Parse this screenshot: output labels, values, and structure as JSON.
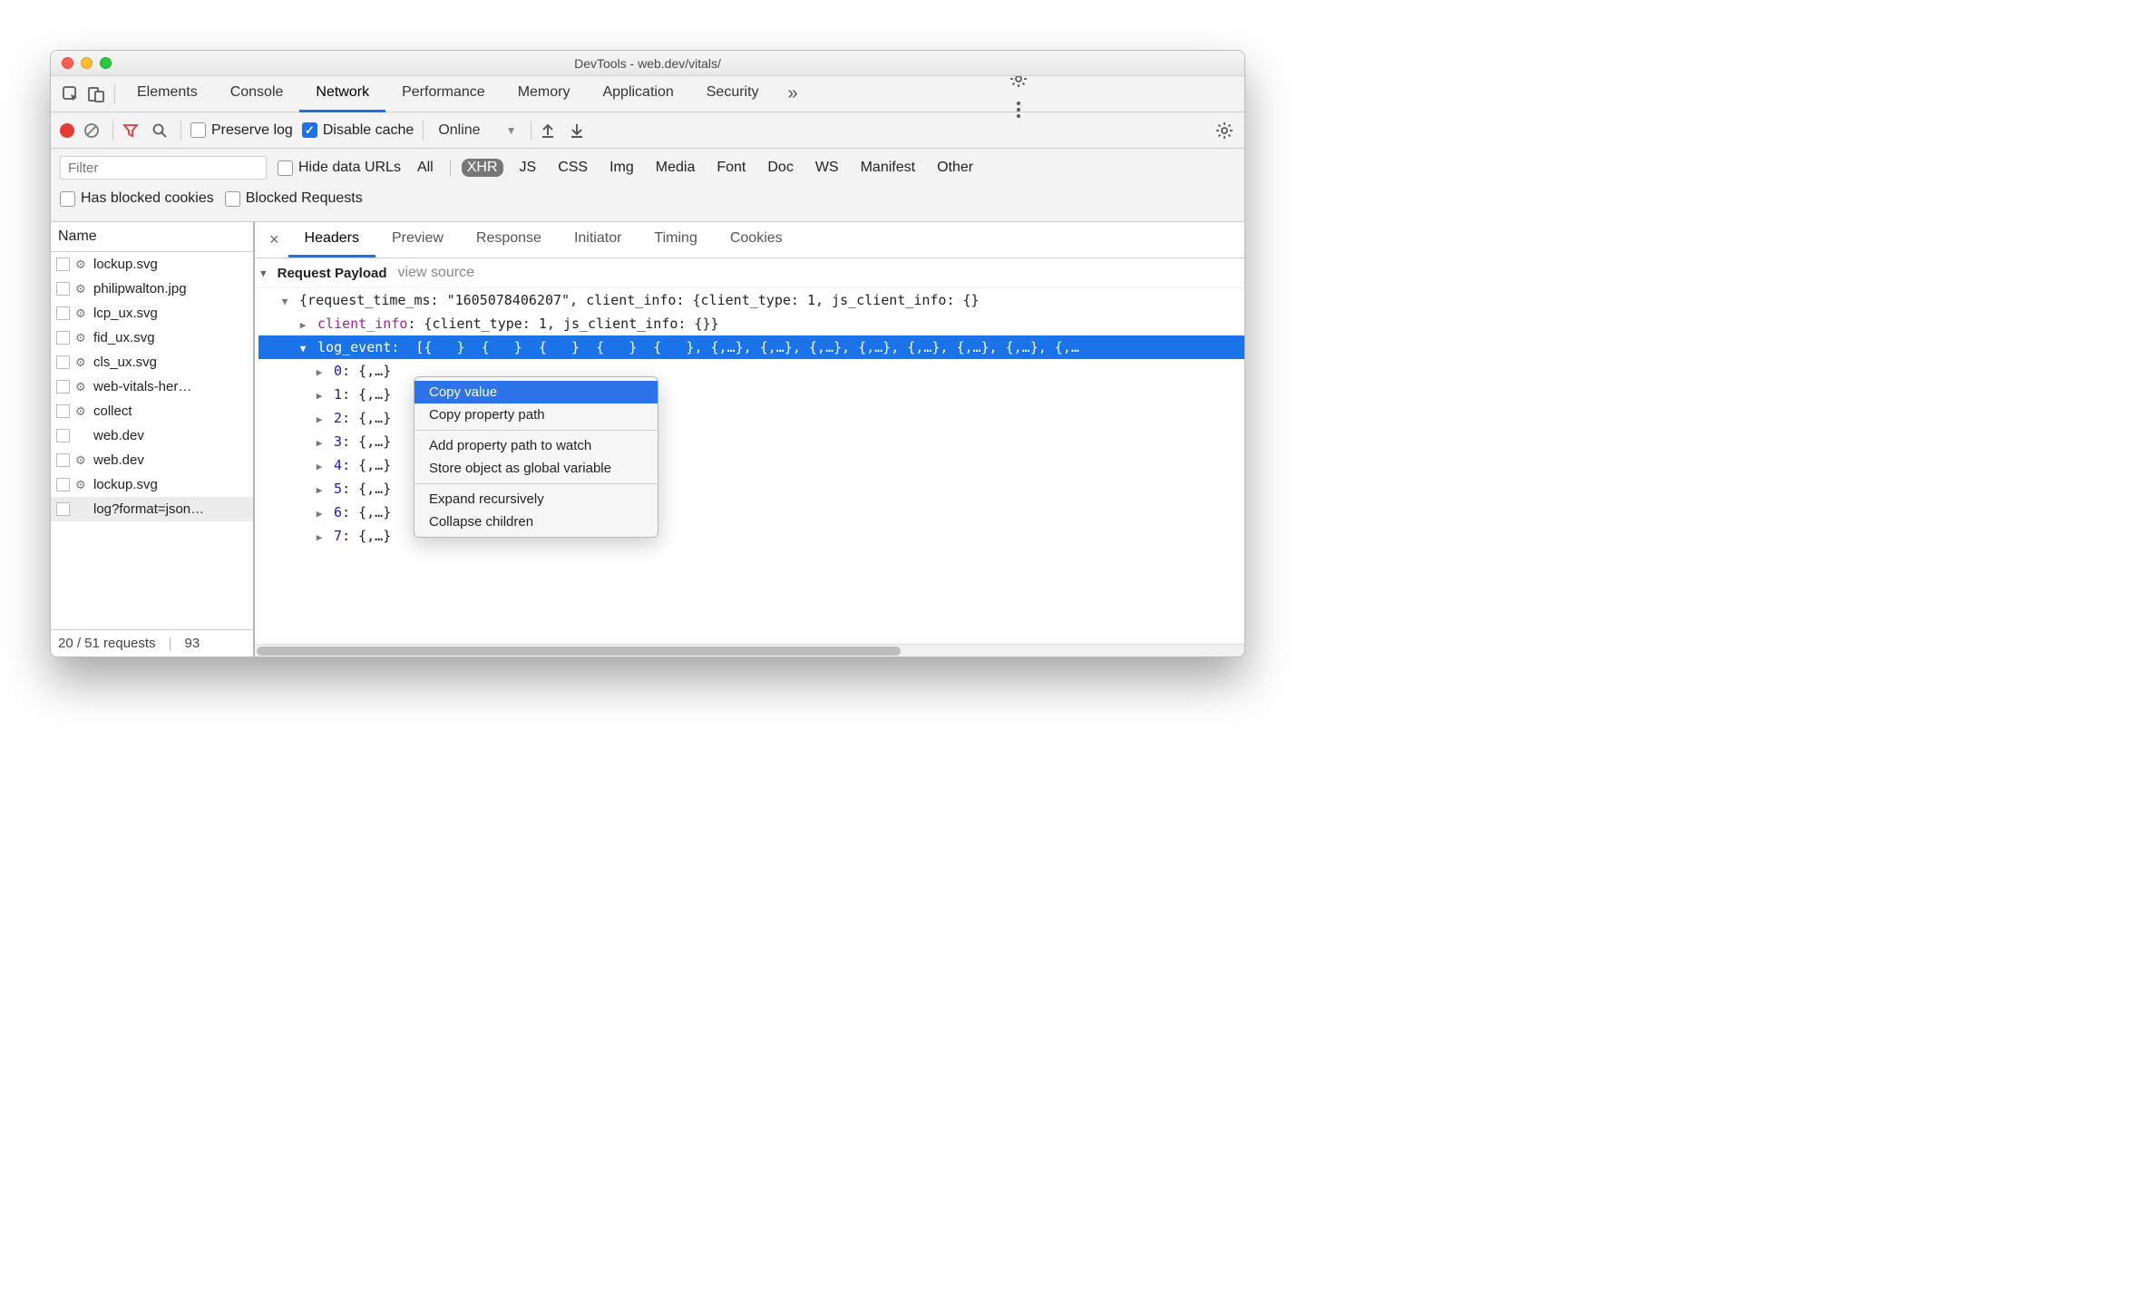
{
  "window": {
    "title": "DevTools - web.dev/vitals/"
  },
  "main_tabs": {
    "items": [
      "Elements",
      "Console",
      "Network",
      "Performance",
      "Memory",
      "Application",
      "Security"
    ],
    "active": "Network"
  },
  "toolbar": {
    "preserve_log": "Preserve log",
    "disable_cache": "Disable cache",
    "throttling": "Online"
  },
  "filter": {
    "placeholder": "Filter",
    "hide_data_urls": "Hide data URLs",
    "types": [
      "All",
      "XHR",
      "JS",
      "CSS",
      "Img",
      "Media",
      "Font",
      "Doc",
      "WS",
      "Manifest",
      "Other"
    ],
    "active_type": "XHR",
    "has_blocked": "Has blocked cookies",
    "blocked_requests": "Blocked Requests"
  },
  "request_list": {
    "header": "Name",
    "items": [
      {
        "name": "lockup.svg",
        "gear": true
      },
      {
        "name": "philipwalton.jpg",
        "gear": true
      },
      {
        "name": "lcp_ux.svg",
        "gear": true
      },
      {
        "name": "fid_ux.svg",
        "gear": true
      },
      {
        "name": "cls_ux.svg",
        "gear": true
      },
      {
        "name": "web-vitals-her…",
        "gear": true
      },
      {
        "name": "collect",
        "gear": true
      },
      {
        "name": "web.dev",
        "gear": false
      },
      {
        "name": "web.dev",
        "gear": true
      },
      {
        "name": "lockup.svg",
        "gear": true
      },
      {
        "name": "log?format=json…",
        "gear": false,
        "selected": true
      }
    ],
    "status": {
      "requests": "20 / 51 requests",
      "extra": "93"
    }
  },
  "detail_tabs": {
    "items": [
      "Headers",
      "Preview",
      "Response",
      "Initiator",
      "Timing",
      "Cookies"
    ],
    "active": "Headers"
  },
  "payload": {
    "section": "Request Payload",
    "view_source": "view source",
    "root": "{request_time_ms: \"1605078406207\", client_info: {client_type: 1, js_client_info: {}",
    "client_info_key": "client_info",
    "client_info_val": ": {client_type: 1, js_client_info: {}}",
    "log_event_key": "log_event",
    "log_event_tail": ", {,…}, {,…}, {,…}, {,…}, {,…}, {,…}, {,…}, {,…",
    "children": [
      {
        "idx": "0",
        "val": "{,…}"
      },
      {
        "idx": "1",
        "val": "{,…}"
      },
      {
        "idx": "2",
        "val": "{,…}"
      },
      {
        "idx": "3",
        "val": "{,…}"
      },
      {
        "idx": "4",
        "val": "{,…}"
      },
      {
        "idx": "5",
        "val": "{,…}"
      },
      {
        "idx": "6",
        "val": "{,…}"
      },
      {
        "idx": "7",
        "val": "{,…}"
      }
    ]
  },
  "context_menu": {
    "items": [
      {
        "label": "Copy value",
        "hl": true
      },
      {
        "label": "Copy property path"
      },
      {
        "sep": true
      },
      {
        "label": "Add property path to watch"
      },
      {
        "label": "Store object as global variable"
      },
      {
        "sep": true
      },
      {
        "label": "Expand recursively"
      },
      {
        "label": "Collapse children"
      }
    ]
  }
}
